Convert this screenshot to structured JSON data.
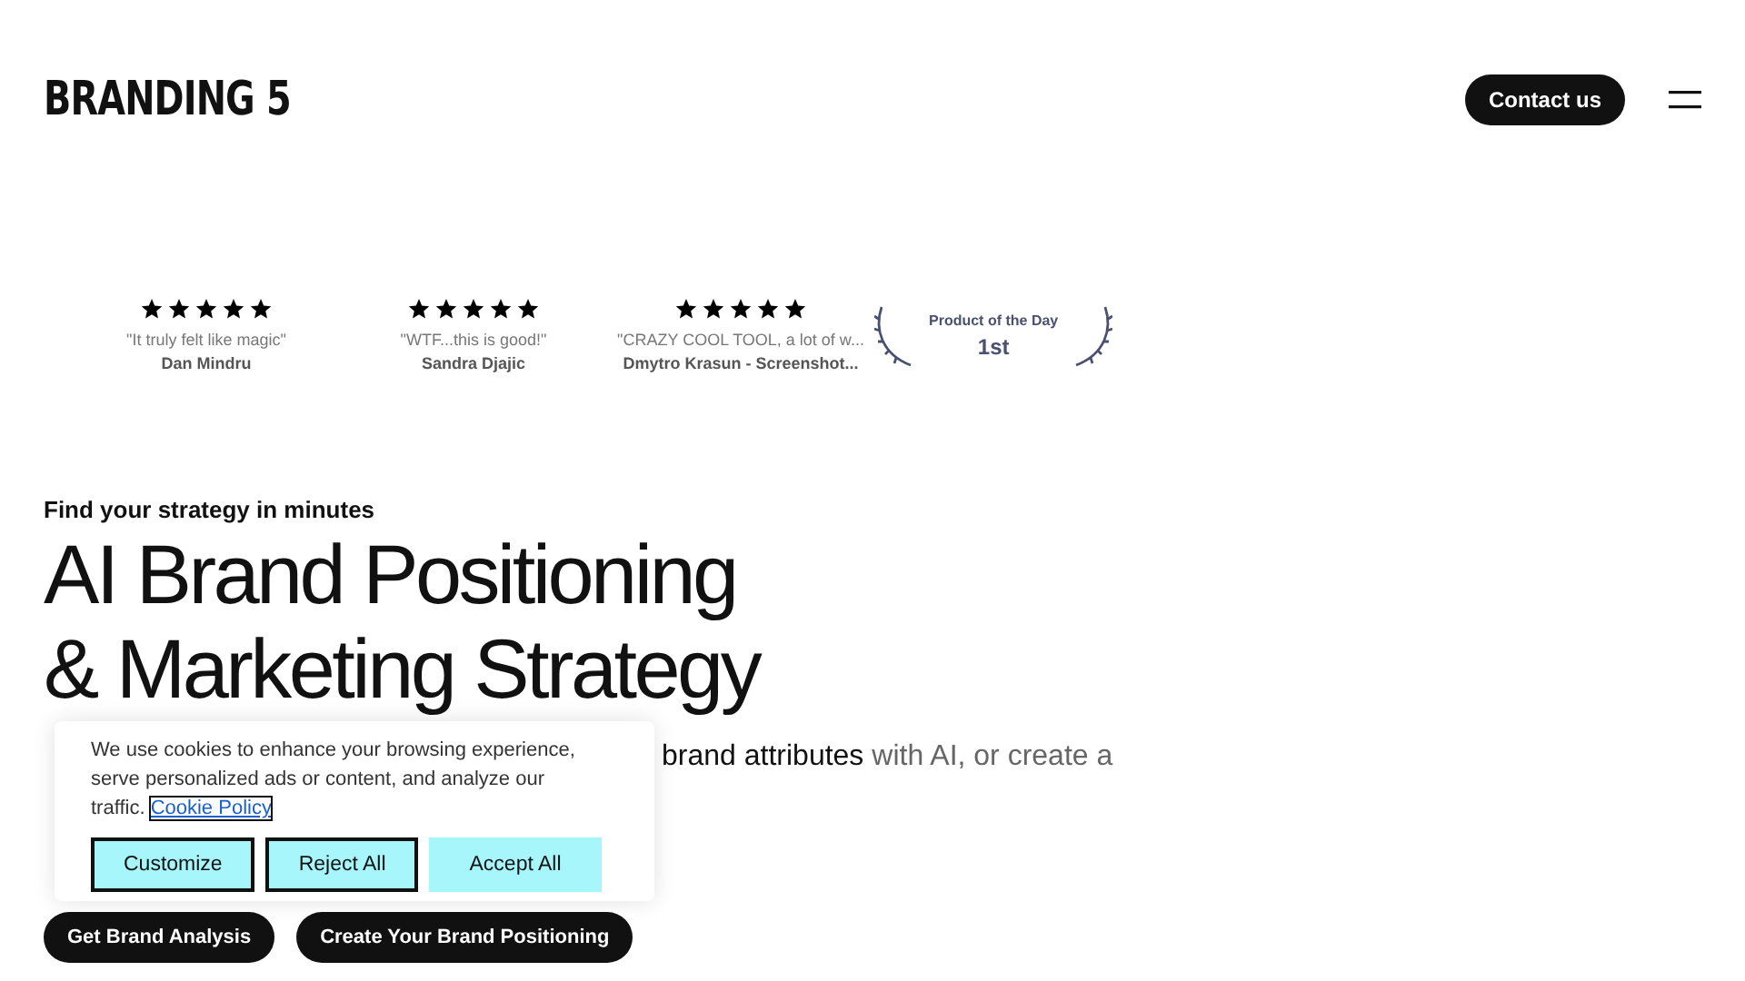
{
  "header": {
    "logo": "BRANDING 5",
    "contact_button": "Contact us"
  },
  "reviews": [
    {
      "stars": 5,
      "quote": "\"It truly felt like magic\"",
      "author": "Dan Mindru"
    },
    {
      "stars": 5,
      "quote": "\"WTF...this is good!\"",
      "author": "Sandra Djajic"
    },
    {
      "stars": 5,
      "quote": "\"CRAZY COOL TOOL, a lot of w...",
      "author": "Dmytro Krasun - Screenshot..."
    }
  ],
  "award": {
    "label": "Product of the Day",
    "rank": "1st"
  },
  "hero": {
    "tagline": "Find your strategy in minutes",
    "title_lines": [
      "AI Brand Positioning",
      "& Marketing Strategy"
    ],
    "paragraph_rest": "**brand attributes** with AI, or create a",
    "buttons": [
      "Get Brand Analysis",
      "Create Your Brand Positioning"
    ]
  },
  "cookie_banner": {
    "text": "We use cookies to enhance your browsing experience, serve personalized ads or content, and analyze our traffic.",
    "link": "Cookie Policy",
    "buttons": [
      {
        "label": "Customize",
        "kind": "outlined"
      },
      {
        "label": "Reject All",
        "kind": "outlined"
      },
      {
        "label": "Accept All",
        "kind": "filled"
      }
    ]
  }
}
